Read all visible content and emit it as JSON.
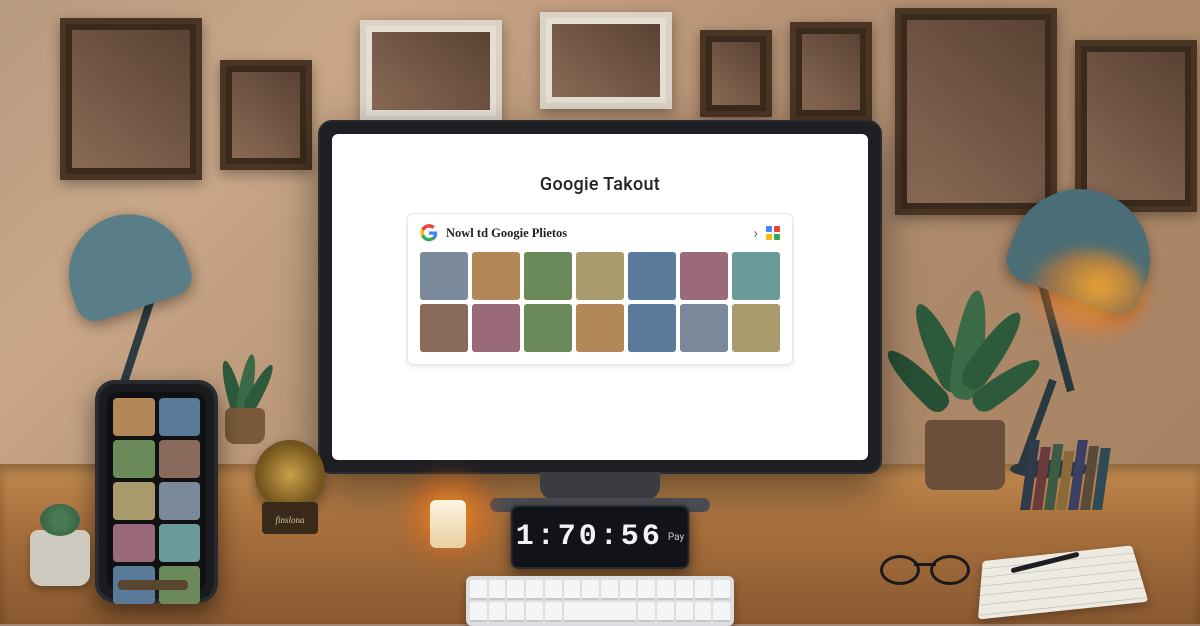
{
  "screen": {
    "title": "Googie Takout",
    "card_label": "Nowl td Googie Plietos",
    "thumbs": 14
  },
  "clock": {
    "time": "1:70:56",
    "suffix": "Pay"
  },
  "trinket_label": "finslona"
}
